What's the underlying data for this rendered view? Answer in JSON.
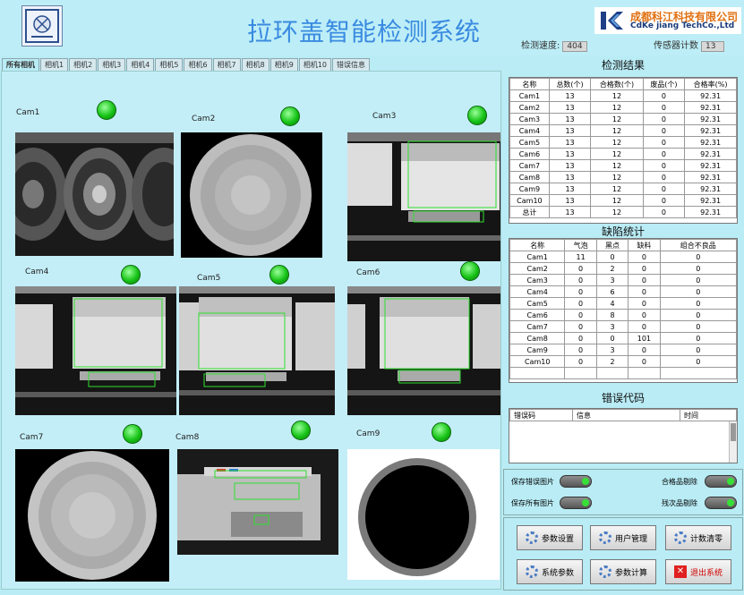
{
  "header": {
    "title": "拉环盖智能检测系统",
    "brand_cn": "成都科江科技有限公司",
    "brand_en": "CdKe jiang TechCo.,Ltd",
    "speed_label": "检测速度:",
    "speed_value": "404",
    "sensor_label": "传感器计数",
    "sensor_value": "13"
  },
  "tabs": [
    "所有相机",
    "相机1",
    "相机2",
    "相机3",
    "相机4",
    "相机5",
    "相机6",
    "相机7",
    "相机8",
    "相机9",
    "相机10",
    "错误信息"
  ],
  "cameras": [
    {
      "label": "Cam1"
    },
    {
      "label": "Cam2"
    },
    {
      "label": "Cam3"
    },
    {
      "label": "Cam4"
    },
    {
      "label": "Cam5"
    },
    {
      "label": "Cam6"
    },
    {
      "label": "Cam7"
    },
    {
      "label": "Cam8"
    },
    {
      "label": "Cam9"
    }
  ],
  "results": {
    "title": "检测结果",
    "headers": [
      "名称",
      "总数(个)",
      "合格数(个)",
      "废品(个)",
      "合格率(%)"
    ],
    "rows": [
      [
        "Cam1",
        "13",
        "12",
        "0",
        "92.31"
      ],
      [
        "Cam2",
        "13",
        "12",
        "0",
        "92.31"
      ],
      [
        "Cam3",
        "13",
        "12",
        "0",
        "92.31"
      ],
      [
        "Cam4",
        "13",
        "12",
        "0",
        "92.31"
      ],
      [
        "Cam5",
        "13",
        "12",
        "0",
        "92.31"
      ],
      [
        "Cam6",
        "13",
        "12",
        "0",
        "92.31"
      ],
      [
        "Cam7",
        "13",
        "12",
        "0",
        "92.31"
      ],
      [
        "Cam8",
        "13",
        "12",
        "0",
        "92.31"
      ],
      [
        "Cam9",
        "13",
        "12",
        "0",
        "92.31"
      ],
      [
        "Cam10",
        "13",
        "12",
        "0",
        "92.31"
      ],
      [
        "总计",
        "13",
        "12",
        "0",
        "92.31"
      ]
    ]
  },
  "defects": {
    "title": "缺陷统计",
    "headers": [
      "名称",
      "气泡",
      "黑点",
      "缺料",
      "组合不良品"
    ],
    "rows": [
      [
        "Cam1",
        "11",
        "0",
        "0",
        "0"
      ],
      [
        "Cam2",
        "0",
        "2",
        "0",
        "0"
      ],
      [
        "Cam3",
        "0",
        "3",
        "0",
        "0"
      ],
      [
        "Cam4",
        "0",
        "6",
        "0",
        "0"
      ],
      [
        "Cam5",
        "0",
        "4",
        "0",
        "0"
      ],
      [
        "Cam6",
        "0",
        "8",
        "0",
        "0"
      ],
      [
        "Cam7",
        "0",
        "3",
        "0",
        "0"
      ],
      [
        "Cam8",
        "0",
        "0",
        "101",
        "0"
      ],
      [
        "Cam9",
        "0",
        "3",
        "0",
        "0"
      ],
      [
        "Cam10",
        "0",
        "2",
        "0",
        "0"
      ],
      [
        "",
        "",
        "",
        "",
        ""
      ]
    ]
  },
  "errors": {
    "title": "错误代码",
    "headers": [
      "错误码",
      "信息",
      "时间"
    ]
  },
  "toggles": {
    "save_error_images": "保存错误图片",
    "save_all_images": "保存所有图片",
    "good_reject": "合格品剔除",
    "bad_reject": "残次品剔除"
  },
  "buttons": {
    "param_set": "参数设置",
    "user_mgmt": "用户管理",
    "count_clear": "计数清零",
    "system_param": "系统参数",
    "param_calc": "参数计算",
    "exit": "退出系统"
  },
  "colors": {
    "background": "#b9ecf5",
    "title": "#3a8be0",
    "led_ok": "#17c417",
    "roi_box": "#2ee02e"
  }
}
